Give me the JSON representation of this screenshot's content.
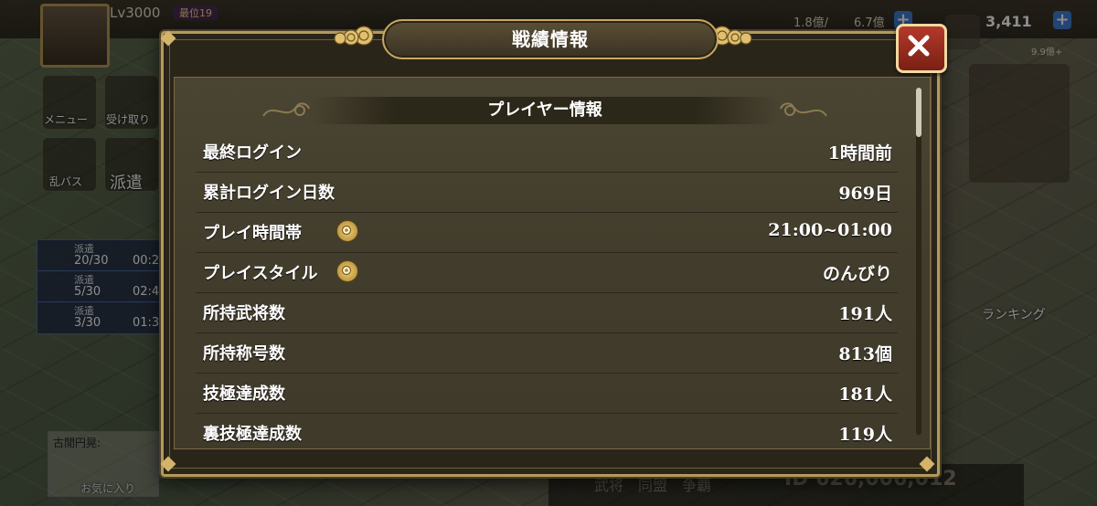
{
  "background": {
    "level": "Lv3000",
    "rank_badge": "最位19",
    "resource_a": "1.8億/",
    "resource_b": "6.7億",
    "gold": "3,411",
    "gold_sub": "9.9億+",
    "menu_label": "メニュー",
    "receive_label": "受け取り",
    "ranbasu_label": "乱バス",
    "dispatch_label": "派遣",
    "ranking_label": "ランキング",
    "dispatch_rows": [
      {
        "title": "派遣",
        "count": "20/30",
        "time": "00:2"
      },
      {
        "title": "派遣",
        "count": "5/30",
        "time": "02:4"
      },
      {
        "title": "派遣",
        "count": "3/30",
        "time": "01:3"
      }
    ],
    "footer_tabs": "武将　同盟　争覇",
    "player_id": "ID 626,006,012",
    "note_name": "古閒円晃:",
    "favorite_label": "お気に入り"
  },
  "modal": {
    "title": "戦績情報",
    "section_title": "プレイヤー情報",
    "rows": [
      {
        "label": "最終ログイン",
        "value": "1時間前"
      },
      {
        "label": "累計ログイン日数",
        "value": "969日"
      },
      {
        "label": "プレイ時間帯",
        "value": "21:00~01:00"
      },
      {
        "label": "プレイスタイル",
        "value": "のんびり"
      },
      {
        "label": "所持武将数",
        "value": "191人"
      },
      {
        "label": "所持称号数",
        "value": "813個"
      },
      {
        "label": "技極達成数",
        "value": "181人"
      },
      {
        "label": "裏技極達成数",
        "value": "119人"
      }
    ]
  },
  "colors": {
    "panel_bg": "#423c2c",
    "frame_gold": "#b39a5c",
    "close_red": "#9a2b1e"
  },
  "icons": {
    "close": "close-x-icon",
    "settings": "gear-icon"
  }
}
